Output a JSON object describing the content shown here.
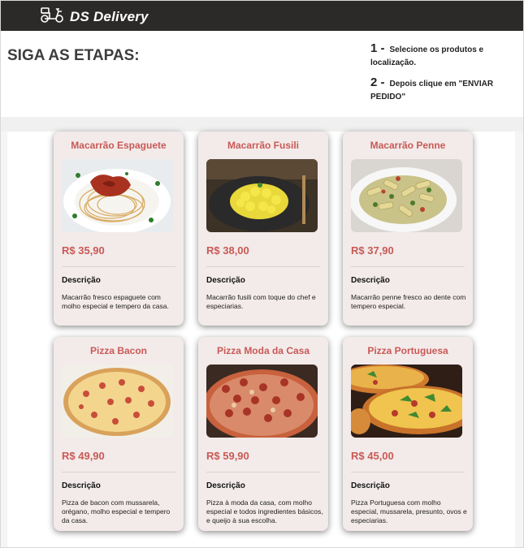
{
  "brand": {
    "name": "DS Delivery",
    "logo_icon": "scooter-icon"
  },
  "steps": {
    "title": "SIGA AS ETAPAS:",
    "step1": {
      "num": "1 -",
      "text": "Selecione os produtos e localização."
    },
    "step2": {
      "num": "2 -",
      "text": "Depois clique em \"ENVIAR PEDIDO\""
    }
  },
  "products": [
    {
      "name": "Macarrão Espaguete",
      "price": "R$ 35,90",
      "desc_label": "Descrição",
      "desc": "Macarrão fresco espaguete com molho especial e tempero da casa."
    },
    {
      "name": "Macarrão Fusili",
      "price": "R$ 38,00",
      "desc_label": "Descrição",
      "desc": "Macarrão fusili com toque do chef e especiarias."
    },
    {
      "name": "Macarrão Penne",
      "price": "R$ 37,90",
      "desc_label": "Descrição",
      "desc": "Macarrão penne fresco ao dente com tempero especial."
    },
    {
      "name": "Pizza Bacon",
      "price": "R$ 49,90",
      "desc_label": "Descrição",
      "desc": "Pizza de bacon com mussarela, orégano, molho especial e tempero da casa."
    },
    {
      "name": "Pizza Moda da Casa",
      "price": "R$ 59,90",
      "desc_label": "Descrição",
      "desc": "Pizza à moda da casa, com molho especial e todos ingredientes básicos, e queijo à sua escolha."
    },
    {
      "name": "Pizza Portuguesa",
      "price": "R$ 45,00",
      "desc_label": "Descrição",
      "desc": "Pizza Portuguesa com molho especial, mussarela, presunto, ovos e especiarias."
    }
  ],
  "colors": {
    "navbar": "#2b2a29",
    "accent": "#c85a55",
    "card_bg": "#f3eaea"
  }
}
